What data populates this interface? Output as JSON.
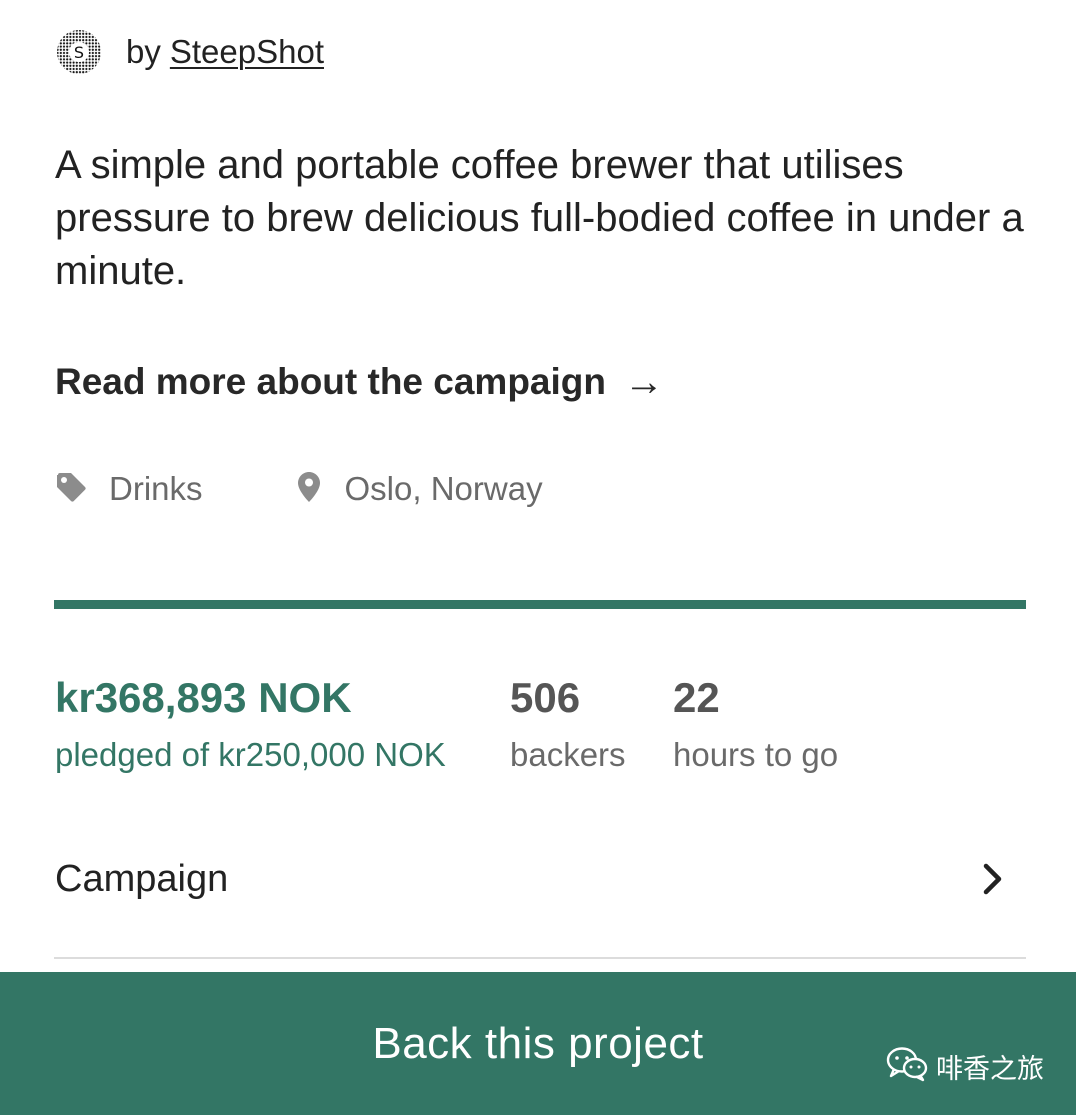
{
  "creator": {
    "prefix": "by",
    "name": "SteepShot",
    "avatar_icon": "steepshot-logo-icon"
  },
  "project": {
    "description": "A simple and portable coffee brewer that utilises pressure to brew delicious full-bodied coffee in under a minute.",
    "read_more_label": "Read more about the campaign",
    "read_more_arrow": "→",
    "category": {
      "label": "Drinks",
      "icon": "tag-icon"
    },
    "location": {
      "label": "Oslo, Norway",
      "icon": "map-pin-icon"
    }
  },
  "funding": {
    "progress": 1.0,
    "pledged": "kr368,893 NOK",
    "pledged_caption": "pledged of kr250,000 NOK",
    "backers_count": "506",
    "backers_caption": "backers",
    "time_left": "22",
    "time_caption": "hours to go"
  },
  "nav": {
    "campaign_label": "Campaign",
    "chevron_icon": "chevron-right-icon"
  },
  "cta": {
    "back_label": "Back this project"
  },
  "watermark": {
    "icon": "wechat-icon",
    "text": "啡香之旅"
  },
  "colors": {
    "accent": "#337665",
    "text": "#222222",
    "muted": "#6a6a6a",
    "divider": "#dcdcdc"
  }
}
